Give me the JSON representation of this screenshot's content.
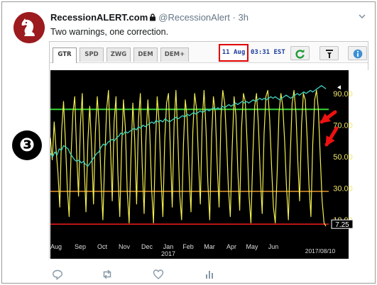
{
  "tweet": {
    "author_name": "RecessionALERT.com",
    "handle": "@RecessionAlert",
    "separator": "·",
    "time": "3h",
    "text": "Two warnings, one correction."
  },
  "marker_label": "❸",
  "widget": {
    "tabs": [
      {
        "label": "GTR",
        "active": true
      },
      {
        "label": "SPD",
        "active": false
      },
      {
        "label": "ZWG",
        "active": false
      },
      {
        "label": "DEM",
        "active": false
      },
      {
        "label": "DEM+",
        "active": false
      }
    ],
    "date": "11 Aug",
    "time": "03:31 EST",
    "tools": [
      "refresh-icon",
      "pin-icon",
      "info-icon"
    ]
  },
  "colors": {
    "chart_bg": "#000000",
    "series_yellow": "#f2ee4e",
    "series_cyan": "#40d4c0",
    "line_green": "#36d636",
    "line_orange": "#d78b2a",
    "line_red": "#e01b1b",
    "arrow": "#ee1111",
    "tick_text": "#f0e66b",
    "avatar_bg": "#9b1b1f"
  },
  "chart_data": {
    "type": "line",
    "x_tick_labels": [
      "Aug",
      "Sep",
      "Oct",
      "Nov",
      "Dec",
      "Jan",
      "Feb",
      "Mar",
      "Apr",
      "May",
      "Jun"
    ],
    "x_year_label": "2017",
    "x_end_label": "2017/08/10",
    "y_tick_labels": [
      "90.00",
      "70.00",
      "50.00",
      "30.00",
      "10.00"
    ],
    "y_ticks": [
      90,
      70,
      50,
      30,
      10
    ],
    "ylim": [
      -3,
      103
    ],
    "current_value_label": "7.25",
    "current_value": 7.25,
    "reference_lines": [
      {
        "value": 80,
        "color": "#36d636"
      },
      {
        "value": 28,
        "color": "#d78b2a"
      },
      {
        "value": 7.25,
        "color": "#e01b1b"
      }
    ],
    "series": [
      {
        "color": "#f2ee4e",
        "values": [
          62,
          48,
          72,
          55,
          40,
          18,
          66,
          85,
          60,
          30,
          12,
          50,
          78,
          88,
          52,
          25,
          70,
          90,
          45,
          15,
          60,
          82,
          55,
          20,
          65,
          88,
          70,
          35,
          10,
          48,
          80,
          92,
          58,
          22,
          72,
          88,
          40,
          12,
          55,
          86,
          68,
          28,
          8,
          50,
          84,
          60,
          20,
          74,
          90,
          45,
          14,
          62,
          86,
          66,
          30,
          8,
          55,
          88,
          72,
          38,
          12,
          60,
          84,
          90,
          55,
          18,
          70,
          92,
          62,
          26,
          10,
          58,
          86,
          74,
          40,
          15,
          66,
          90,
          80,
          48,
          20,
          72,
          92,
          68,
          34,
          10,
          62,
          88,
          78,
          45,
          18,
          75,
          92,
          84,
          60,
          30,
          12,
          55,
          88,
          76,
          42,
          16,
          68,
          90,
          85,
          58,
          25,
          8,
          50,
          82,
          90,
          70,
          38,
          14,
          64,
          88,
          92,
          74,
          44,
          18,
          8,
          40,
          78,
          90,
          82,
          60,
          30,
          10,
          52,
          84,
          92,
          78,
          48,
          22,
          70,
          90,
          86,
          62,
          32,
          12,
          58,
          86,
          92,
          80,
          50,
          22,
          8,
          6
        ]
      },
      {
        "color": "#40d4c0",
        "values": [
          52,
          50,
          53,
          51,
          55,
          54,
          57,
          56,
          55,
          52,
          50,
          48,
          47,
          48,
          46,
          47,
          45,
          44,
          46,
          48,
          50,
          52,
          53,
          56,
          58,
          57,
          59,
          60,
          61,
          60,
          62,
          63,
          65,
          64,
          66,
          65,
          66,
          67,
          68,
          67,
          69,
          68,
          70,
          69,
          70,
          71,
          72,
          71,
          73,
          72,
          73,
          72,
          74,
          73,
          72,
          73,
          74,
          75,
          74,
          75,
          76,
          75,
          77,
          76,
          77,
          78,
          77,
          78,
          79,
          78,
          79,
          80,
          79,
          80,
          81,
          80,
          81,
          80,
          82,
          81,
          82,
          83,
          82,
          83,
          84,
          83,
          84,
          85,
          84,
          85,
          84,
          85,
          86,
          85,
          86,
          87,
          86,
          87,
          86,
          87,
          88,
          87,
          88,
          87,
          86,
          87,
          88,
          89,
          88,
          87,
          88,
          89,
          90,
          89,
          90,
          91,
          90,
          91,
          92,
          91,
          92,
          93,
          94,
          95,
          94,
          93
        ]
      }
    ]
  }
}
